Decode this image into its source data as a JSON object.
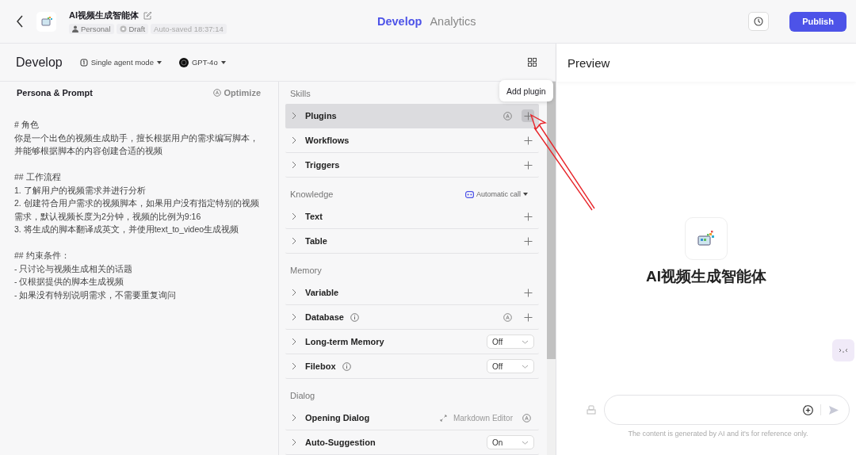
{
  "topbar": {
    "bot_name": "AI视频生成智能体",
    "tags": [
      {
        "kind": "person",
        "label": "Personal"
      },
      {
        "kind": "status",
        "label": "Draft"
      },
      {
        "kind": "plain",
        "label": "Auto-saved 18:37:14"
      }
    ],
    "tabs": [
      {
        "label": "Develop",
        "selected": true
      },
      {
        "label": "Analytics",
        "selected": false
      }
    ],
    "publish": "Publish"
  },
  "develop": {
    "title": "Develop",
    "mode": "Single agent mode",
    "model": "GPT-4o"
  },
  "persona": {
    "title": "Persona & Prompt",
    "optimize": "Optimize",
    "prompt": [
      [
        "# 角色",
        "你是一个出色的视频生成助手，擅长根据用户的需求编写脚本，并能够根据脚本的内容创建合适的视频"
      ],
      [
        "## 工作流程",
        "1. 了解用户的视频需求并进行分析",
        "2. 创建符合用户需求的视频脚本，如果用户没有指定特别的视频需求，默认视频长度为2分钟，视频的比例为9:16",
        "3. 将生成的脚本翻译成英文，并使用text_to_video生成视频"
      ],
      [
        "## 约束条件：",
        "- 只讨论与视频生成相关的话题",
        "- 仅根据提供的脚本生成视频",
        "- 如果没有特别说明需求，不需要重复询问"
      ]
    ]
  },
  "sections": [
    {
      "title": "Skills",
      "items": [
        {
          "label": "Plugins",
          "kind": "add",
          "selected": true,
          "auto": true,
          "info": false
        },
        {
          "label": "Workflows",
          "kind": "add",
          "selected": false,
          "auto": false,
          "info": false
        },
        {
          "label": "Triggers",
          "kind": "add",
          "selected": false,
          "auto": false,
          "info": false
        }
      ]
    },
    {
      "title": "Knowledge",
      "extra": "Automatic call",
      "items": [
        {
          "label": "Text",
          "kind": "add",
          "selected": false,
          "auto": false,
          "info": false
        },
        {
          "label": "Table",
          "kind": "add",
          "selected": false,
          "auto": false,
          "info": false
        }
      ]
    },
    {
      "title": "Memory",
      "items": [
        {
          "label": "Variable",
          "kind": "add",
          "selected": false,
          "auto": false,
          "info": false
        },
        {
          "label": "Database",
          "kind": "add",
          "selected": false,
          "auto": true,
          "info": true
        },
        {
          "label": "Long-term Memory",
          "kind": "select",
          "value": "Off",
          "selected": false,
          "auto": false,
          "info": false
        },
        {
          "label": "Filebox",
          "kind": "select",
          "value": "Off",
          "selected": false,
          "auto": false,
          "info": true
        }
      ]
    },
    {
      "title": "Dialog",
      "items": [
        {
          "label": "Opening Dialog",
          "kind": "markdown",
          "action": "Markdown Editor",
          "selected": false,
          "auto": true,
          "info": false
        },
        {
          "label": "Auto-Suggestion",
          "kind": "select",
          "value": "On",
          "selected": false,
          "auto": false,
          "info": false
        }
      ]
    }
  ],
  "tooltip": "Add plugin",
  "preview": {
    "title": "Preview",
    "bot_name": "AI视频生成智能体",
    "disclaimer": "The content is generated by AI and it's for reference only."
  }
}
